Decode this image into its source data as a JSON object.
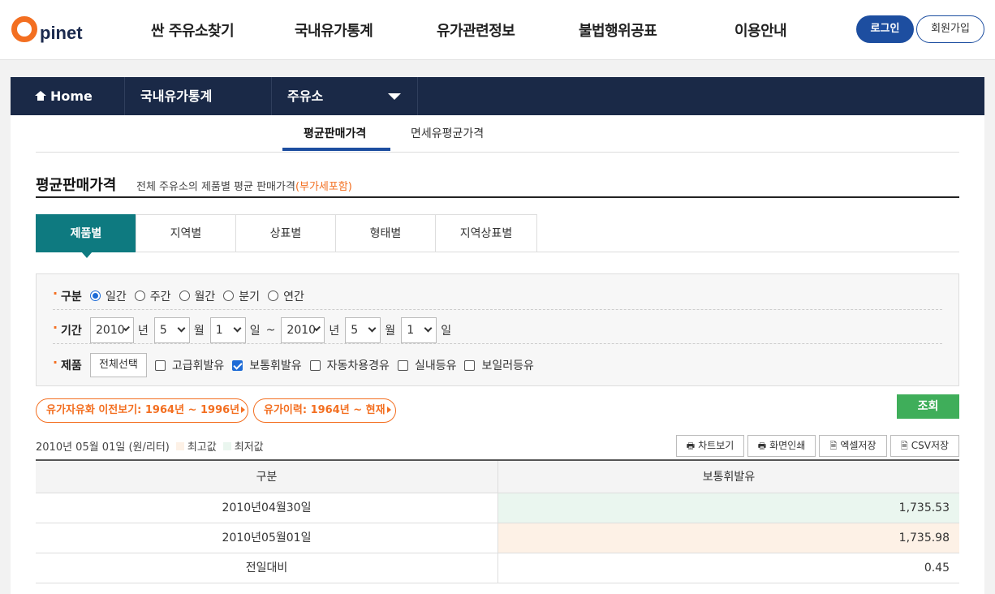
{
  "header": {
    "logo_text": "pinet",
    "menu": [
      "싼 주유소찾기",
      "국내유가통계",
      "유가관련정보",
      "불법행위공표",
      "이용안내"
    ],
    "login_label": "로그인",
    "join_label": "회원가입"
  },
  "locbar": {
    "home_label": "Home",
    "level1": "국내유가통계",
    "level2": "주유소"
  },
  "subtabs": [
    "평균판매가격",
    "면세유평균가격"
  ],
  "page": {
    "title": "평균판매가격",
    "desc": "전체 주유소의 제품별 평균 판매가격",
    "vat_note": "(부가세포함)"
  },
  "tabs": [
    "제품별",
    "지역별",
    "상표별",
    "형태별",
    "지역상표별"
  ],
  "search": {
    "period_type_label": "구분",
    "period_types": [
      "일간",
      "주간",
      "월간",
      "분기",
      "연간"
    ],
    "selected_period_type": "일간",
    "range_label": "기간",
    "from": {
      "year": "2010",
      "month": "5",
      "day": "1"
    },
    "to": {
      "year": "2010",
      "month": "5",
      "day": "1"
    },
    "unit_year": "년",
    "unit_month": "월",
    "unit_day": "일",
    "tilde": "~",
    "product_label": "제품",
    "select_all_label": "전체선택",
    "products": [
      {
        "label": "고급휘발유",
        "checked": false
      },
      {
        "label": "보통휘발유",
        "checked": true
      },
      {
        "label": "자동차용경유",
        "checked": false
      },
      {
        "label": "실내등유",
        "checked": false
      },
      {
        "label": "보일러등유",
        "checked": false
      }
    ]
  },
  "history_buttons": [
    "유가자유화 이전보기: 1964년 ~ 1996년",
    "유가이력: 1964년 ~ 현재"
  ],
  "search_button": "조회",
  "info": {
    "date_unit": "2010년 05월 01일 (원/리터)",
    "legend_high": "최고값",
    "legend_low": "최저값",
    "high_color": "#fdf1e6",
    "low_color": "#eaf6ef"
  },
  "tools": [
    "차트보기",
    "화면인쇄",
    "엑셀저장",
    "CSV저장"
  ],
  "table": {
    "headers": [
      "구분",
      "보통휘발유"
    ],
    "rows": [
      {
        "label": "2010년04월30일",
        "value": "1,735.53",
        "highlight": "low"
      },
      {
        "label": "2010년05월01일",
        "value": "1,735.98",
        "highlight": "high"
      },
      {
        "label": "전일대비",
        "value": "0.45",
        "highlight": "none"
      }
    ]
  }
}
